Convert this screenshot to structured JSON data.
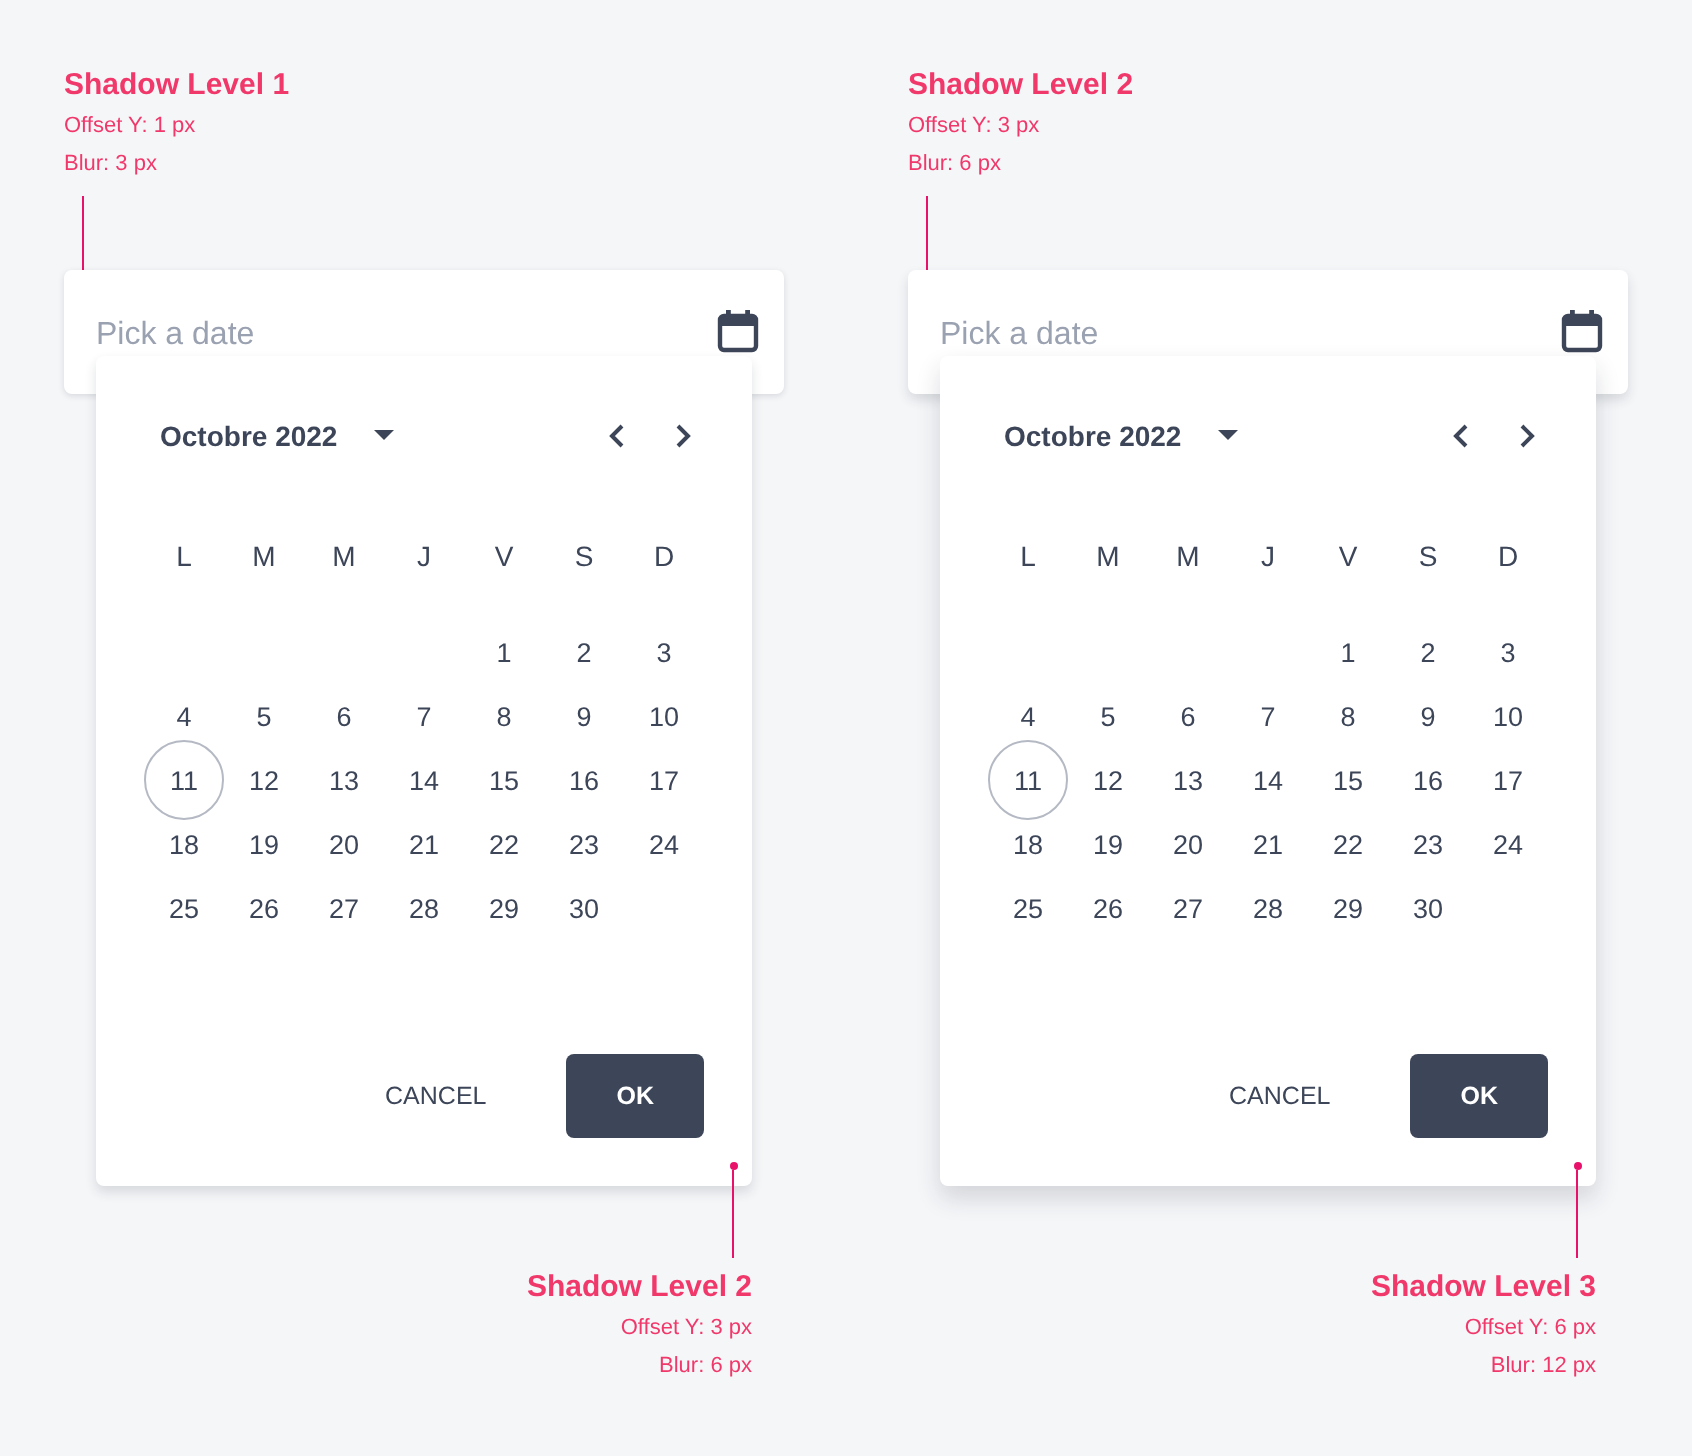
{
  "panels": [
    {
      "top_note": {
        "title": "Shadow Level 1",
        "offset": "Offset Y: 1 px",
        "blur": "Blur: 3 px"
      },
      "field": {
        "placeholder": "Pick a date",
        "kind": "low"
      },
      "calendar": {
        "kind": "medium",
        "month": "Octobre 2022",
        "weekdays": [
          "L",
          "M",
          "M",
          "J",
          "V",
          "S",
          "D"
        ],
        "weeks": [
          {
            "kind": "leading",
            "days": [
              {
                "label": "1",
                "selected": false
              },
              {
                "label": "2",
                "selected": false
              },
              {
                "label": "3",
                "selected": false
              }
            ]
          },
          {
            "kind": "full",
            "days": [
              {
                "label": "4",
                "selected": false
              },
              {
                "label": "5",
                "selected": false
              },
              {
                "label": "6",
                "selected": false
              },
              {
                "label": "7",
                "selected": false
              },
              {
                "label": "8",
                "selected": false
              },
              {
                "label": "9",
                "selected": false
              },
              {
                "label": "10",
                "selected": false
              }
            ]
          },
          {
            "kind": "full",
            "days": [
              {
                "label": "11",
                "selected": true
              },
              {
                "label": "12",
                "selected": false
              },
              {
                "label": "13",
                "selected": false
              },
              {
                "label": "14",
                "selected": false
              },
              {
                "label": "15",
                "selected": false
              },
              {
                "label": "16",
                "selected": false
              },
              {
                "label": "17",
                "selected": false
              }
            ]
          },
          {
            "kind": "full",
            "days": [
              {
                "label": "18",
                "selected": false
              },
              {
                "label": "19",
                "selected": false
              },
              {
                "label": "20",
                "selected": false
              },
              {
                "label": "21",
                "selected": false
              },
              {
                "label": "22",
                "selected": false
              },
              {
                "label": "23",
                "selected": false
              },
              {
                "label": "24",
                "selected": false
              }
            ]
          },
          {
            "kind": "full",
            "days": [
              {
                "label": "25",
                "selected": false
              },
              {
                "label": "26",
                "selected": false
              },
              {
                "label": "27",
                "selected": false
              },
              {
                "label": "28",
                "selected": false
              },
              {
                "label": "29",
                "selected": false
              },
              {
                "label": "30",
                "selected": false
              }
            ]
          }
        ],
        "buttons": [
          "CANCEL",
          "OK"
        ]
      },
      "bottom_note": {
        "title": "Shadow Level 2",
        "offset": "Offset Y: 3 px",
        "blur": "Blur: 6 px"
      }
    },
    {
      "top_note": {
        "title": "Shadow Level 2",
        "offset": "Offset Y: 3 px",
        "blur": "Blur: 6 px"
      },
      "field": {
        "placeholder": "Pick a date",
        "kind": "medium"
      },
      "calendar": {
        "kind": "high",
        "month": "Octobre 2022",
        "weekdays": [
          "L",
          "M",
          "M",
          "J",
          "V",
          "S",
          "D"
        ],
        "weeks": [
          {
            "kind": "leading",
            "days": [
              {
                "label": "1",
                "selected": false
              },
              {
                "label": "2",
                "selected": false
              },
              {
                "label": "3",
                "selected": false
              }
            ]
          },
          {
            "kind": "full",
            "days": [
              {
                "label": "4",
                "selected": false
              },
              {
                "label": "5",
                "selected": false
              },
              {
                "label": "6",
                "selected": false
              },
              {
                "label": "7",
                "selected": false
              },
              {
                "label": "8",
                "selected": false
              },
              {
                "label": "9",
                "selected": false
              },
              {
                "label": "10",
                "selected": false
              }
            ]
          },
          {
            "kind": "full",
            "days": [
              {
                "label": "11",
                "selected": true
              },
              {
                "label": "12",
                "selected": false
              },
              {
                "label": "13",
                "selected": false
              },
              {
                "label": "14",
                "selected": false
              },
              {
                "label": "15",
                "selected": false
              },
              {
                "label": "16",
                "selected": false
              },
              {
                "label": "17",
                "selected": false
              }
            ]
          },
          {
            "kind": "full",
            "days": [
              {
                "label": "18",
                "selected": false
              },
              {
                "label": "19",
                "selected": false
              },
              {
                "label": "20",
                "selected": false
              },
              {
                "label": "21",
                "selected": false
              },
              {
                "label": "22",
                "selected": false
              },
              {
                "label": "23",
                "selected": false
              },
              {
                "label": "24",
                "selected": false
              }
            ]
          },
          {
            "kind": "full",
            "days": [
              {
                "label": "25",
                "selected": false
              },
              {
                "label": "26",
                "selected": false
              },
              {
                "label": "27",
                "selected": false
              },
              {
                "label": "28",
                "selected": false
              },
              {
                "label": "29",
                "selected": false
              },
              {
                "label": "30",
                "selected": false
              }
            ]
          }
        ],
        "buttons": [
          "CANCEL",
          "OK"
        ]
      },
      "bottom_note": {
        "title": "Shadow Level 3",
        "offset": "Offset Y: 6 px",
        "blur": "Blur: 12 px"
      }
    }
  ]
}
